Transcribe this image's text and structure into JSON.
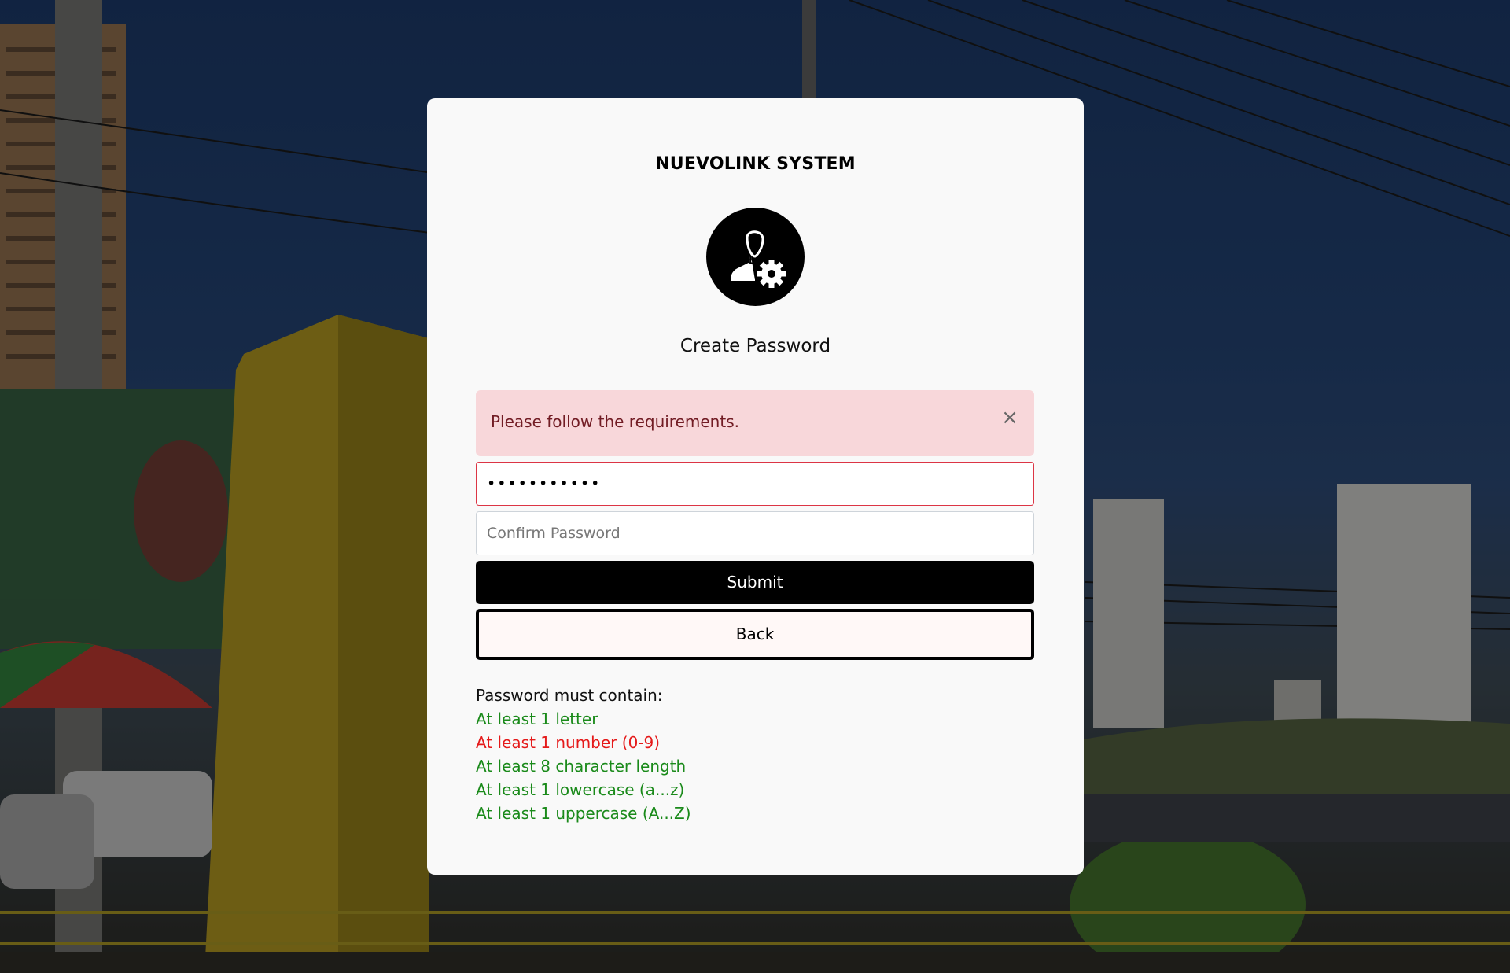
{
  "card": {
    "brand": "NUEVOLINK SYSTEM",
    "subtitle": "Create Password",
    "avatar_icon": "user-settings-icon"
  },
  "alert": {
    "message": "Please follow the requirements.",
    "close_glyph": "×",
    "background": "#f8d7da",
    "text_color": "#721c24"
  },
  "form": {
    "password_value": "•••••••••••",
    "password_border": "#dc3545",
    "confirm_placeholder": "Confirm Password",
    "submit_label": "Submit",
    "back_label": "Back"
  },
  "requirements": {
    "heading": "Password must contain:",
    "items": [
      {
        "label": "At least 1 letter",
        "met": true
      },
      {
        "label": "At least 1 number (0-9)",
        "met": false
      },
      {
        "label": "At least 8 character length",
        "met": true
      },
      {
        "label": "At least 1 lowercase (a...z)",
        "met": true
      },
      {
        "label": "At least 1 uppercase (A...Z)",
        "met": true
      }
    ],
    "met_color": "#1a8a1a",
    "unmet_color": "#e51a1a"
  }
}
